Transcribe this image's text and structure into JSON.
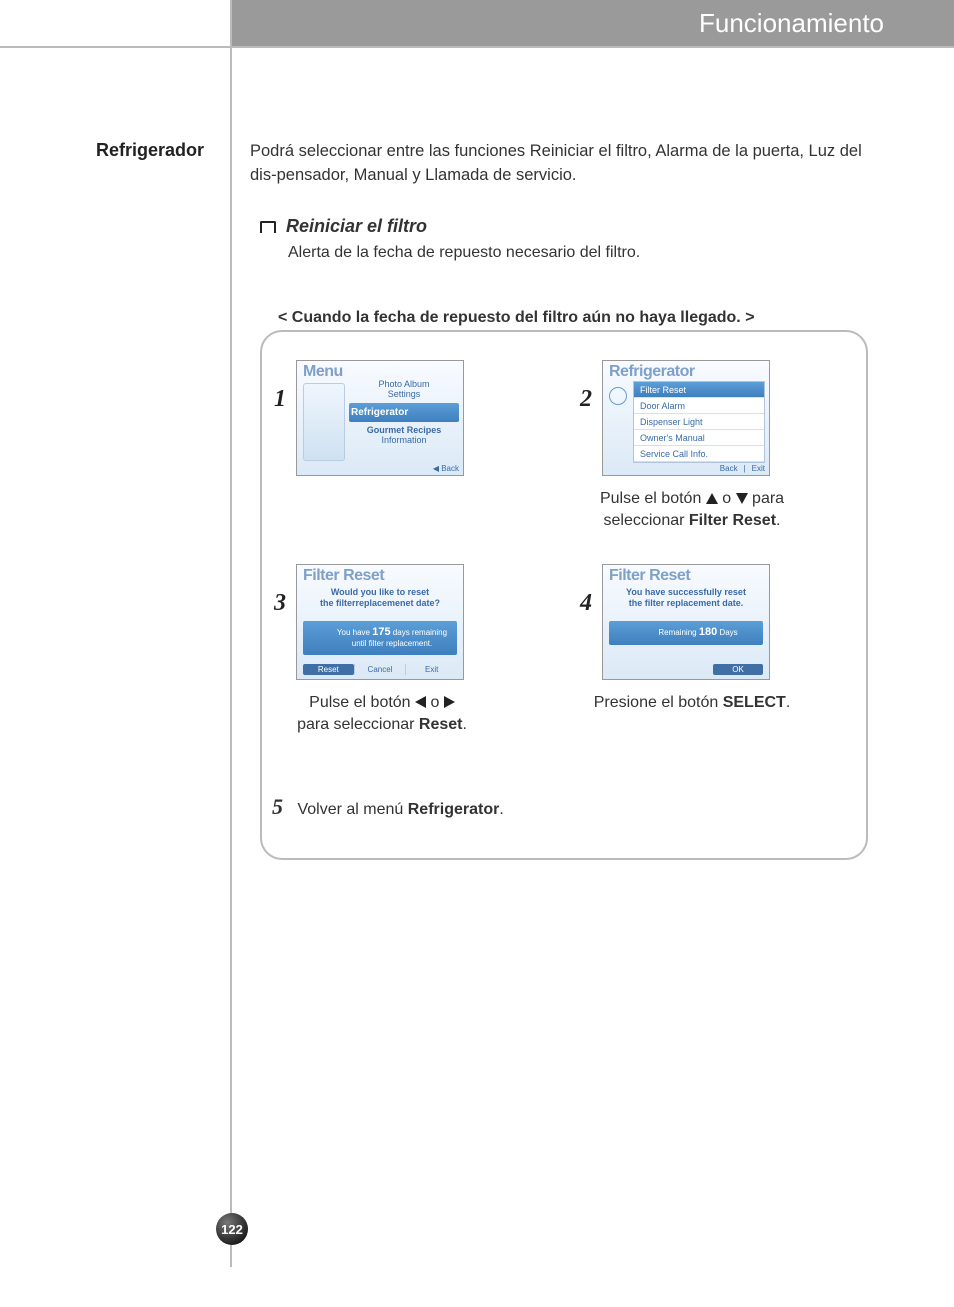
{
  "header": {
    "title": "Funcionamiento"
  },
  "sidebar": {
    "heading": "Refrigerador"
  },
  "intro": "Podrá seleccionar entre las funciones Reiniciar el filtro, Alarma de la puerta, Luz del dis-pensador, Manual y Llamada de servicio.",
  "section": {
    "title": "Reiniciar el filtro",
    "desc": "Alerta de la fecha de repuesto necesario del filtro.",
    "scenario": "< Cuando la fecha de repuesto del filtro aún no haya llegado. >"
  },
  "steps": {
    "s1": {
      "num": "1",
      "title": "Menu",
      "items": [
        "Photo Album",
        "Settings"
      ],
      "selected": "Refrigerator",
      "items_after": [
        "Gourmet Recipes",
        "Information"
      ],
      "back": "◀ Back"
    },
    "s2": {
      "num": "2",
      "title": "Refrigerator",
      "rows": [
        "Filter Reset",
        "Door Alarm",
        "Dispenser Light",
        "Owner's Manual",
        "Service Call Info."
      ],
      "nav": [
        "Back",
        "Exit"
      ],
      "caption_a": "Pulse el botón ",
      "caption_mid": " o ",
      "caption_b": " para seleccionar ",
      "caption_bold": "Filter Reset",
      "caption_end": "."
    },
    "s3": {
      "num": "3",
      "title": "Filter Reset",
      "msg1": "Would you like to reset",
      "msg2": "the filterreplacemenet date?",
      "banner_a": "You have ",
      "banner_days": "175",
      "banner_b": " days remaining",
      "banner_c": "until filter replacement.",
      "btns": [
        "Reset",
        "Cancel",
        "Exit"
      ],
      "caption_a": "Pulse el botón ",
      "caption_mid": " o ",
      "caption_b": " para seleccionar ",
      "caption_bold": "Reset",
      "caption_end": "."
    },
    "s4": {
      "num": "4",
      "title": "Filter Reset",
      "msg1": "You have successfully reset",
      "msg2": "the filter replacement date.",
      "banner_a": "Remaining ",
      "banner_days": "180",
      "banner_b": " Days",
      "ok": "OK",
      "caption_a": "Presione el botón ",
      "caption_bold": "SELECT",
      "caption_end": "."
    },
    "s5": {
      "num": "5",
      "text_a": "Volver al menú ",
      "text_bold": "Refrigerator",
      "text_end": "."
    }
  },
  "page_number": "122"
}
